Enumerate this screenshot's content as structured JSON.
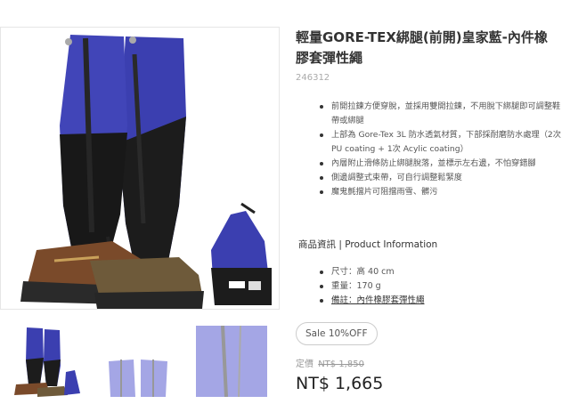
{
  "product": {
    "title": "輕量GORE-TEX綁腿(前開)皇家藍-內件橡膠套彈性繩",
    "sku": "246312",
    "features": [
      "前開拉鍊方便穿脫，並採用雙開拉鍊，不用脫下綁腿即可調整鞋帶或綁腿",
      "上部為 Gore-Tex 3L 防水透氣材質，下部採耐磨防水處理（2次 PU coating + 1次 Acylic coating）",
      "內層附止滑條防止綁腿脫落，並標示左右邊，不怕穿錯腳",
      "側邊調整式束帶，可自行調整鬆緊度",
      "魔鬼氈擋片可阻擋雨雪、髒污"
    ],
    "info_heading": "商品資訊 | Product Information",
    "specs": {
      "size": "尺寸：高 40 cm",
      "weight": "重量：170 g",
      "note": "備註：內件橡膠套彈性繩"
    },
    "sale_badge": "Sale 10%OFF",
    "original_label": "定價",
    "original_price": "NT$ 1,850",
    "price": "NT$ 1,665"
  },
  "colors": {
    "gaiter_blue": "#3b3fb0",
    "gaiter_black": "#1c1c1c",
    "boot_brown": "#7a4a2a"
  },
  "images": {
    "main_icon": "gaiter-product-photo",
    "thumbnails": [
      "gaiter-thumb-worn",
      "gaiter-thumb-front",
      "gaiter-thumb-detail"
    ],
    "pouch_logo": "RUHR"
  }
}
